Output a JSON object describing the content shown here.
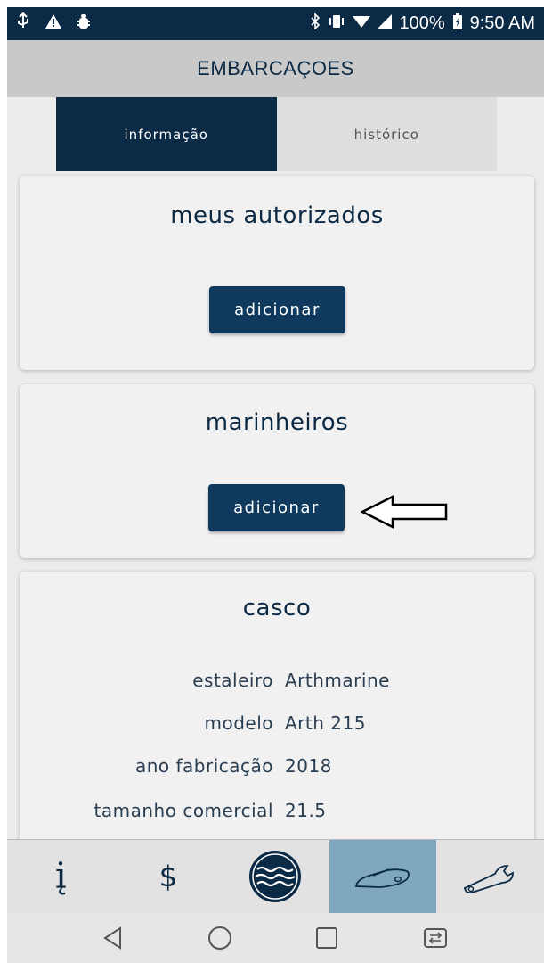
{
  "status_bar": {
    "left_icons": [
      "usb-icon",
      "warning-icon",
      "bug-icon"
    ],
    "battery": "100%",
    "time": "9:50 AM"
  },
  "header": {
    "title": "EMBARCAÇOES"
  },
  "tabs": [
    {
      "label": "informação",
      "active": true
    },
    {
      "label": "histórico",
      "active": false
    }
  ],
  "cards": {
    "authorized": {
      "title": "meus autorizados",
      "button": "adicionar"
    },
    "sailors": {
      "title": "marinheiros",
      "button": "adicionar"
    },
    "hull": {
      "title": "casco",
      "fields": [
        {
          "label": "estaleiro",
          "value": "Arthmarine"
        },
        {
          "label": "modelo",
          "value": "Arth 215"
        },
        {
          "label": "ano fabricação",
          "value": "2018"
        },
        {
          "label": "tamanho comercial",
          "value": "21.5"
        }
      ]
    }
  },
  "bottom_nav": [
    {
      "icon": "info-icon",
      "glyph": "į"
    },
    {
      "icon": "dollar-icon",
      "glyph": "$"
    },
    {
      "icon": "waves-logo-icon"
    },
    {
      "icon": "boat-icon",
      "active": true
    },
    {
      "icon": "wrench-icon"
    }
  ],
  "colors": {
    "primary": "#0b2a45",
    "button": "#103a5d",
    "active_nav": "#7fa8c0",
    "header_bg": "#c9c9c9"
  }
}
